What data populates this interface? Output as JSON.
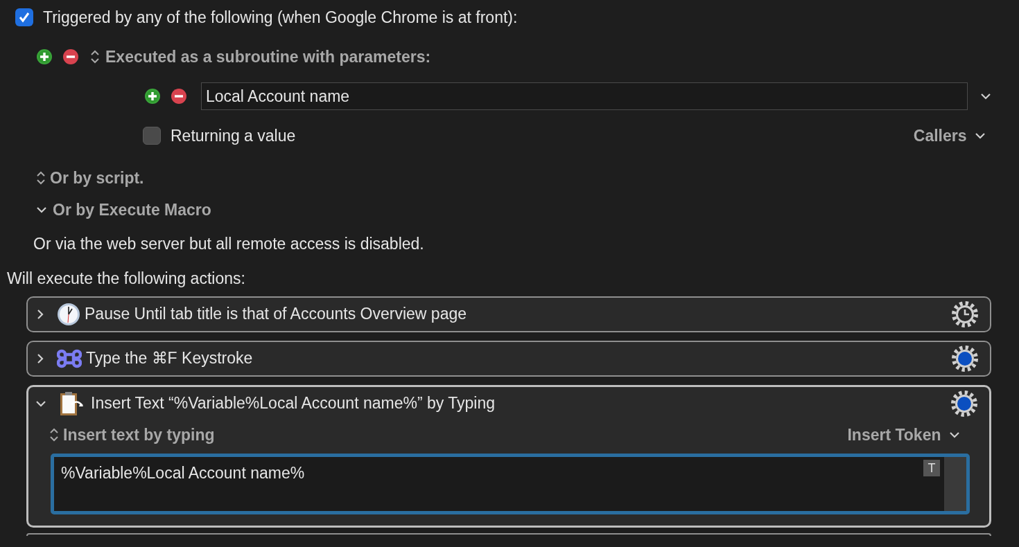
{
  "trigger": {
    "label": "Triggered by any of the following (when Google Chrome is at front):",
    "checked": true
  },
  "subroutine": {
    "label": "Executed as a subroutine with parameters:",
    "parameters": [
      {
        "value": "Local Account name"
      }
    ],
    "returning": {
      "label": "Returning a value",
      "checked": false
    },
    "callers": "Callers"
  },
  "or_script": {
    "label": "Or by script."
  },
  "or_execute_macro": {
    "label": "Or by Execute Macro",
    "expanded": true
  },
  "web_server_note": "Or via the web server but all remote access is disabled.",
  "actions_heading": "Will execute the following actions:",
  "actions": [
    {
      "kind": "pause",
      "title": "Pause Until tab title is that of Accounts Overview page",
      "expanded": false
    },
    {
      "kind": "keystroke",
      "title": "Type the ⌘F Keystroke",
      "expanded": false
    },
    {
      "kind": "insert_text",
      "title": "Insert Text “%Variable%Local Account name%” by Typing",
      "expanded": true,
      "mode_label": "Insert text by typing",
      "token_button": "Insert Token",
      "text": "%Variable%Local Account name%",
      "text_button": "T"
    }
  ]
}
